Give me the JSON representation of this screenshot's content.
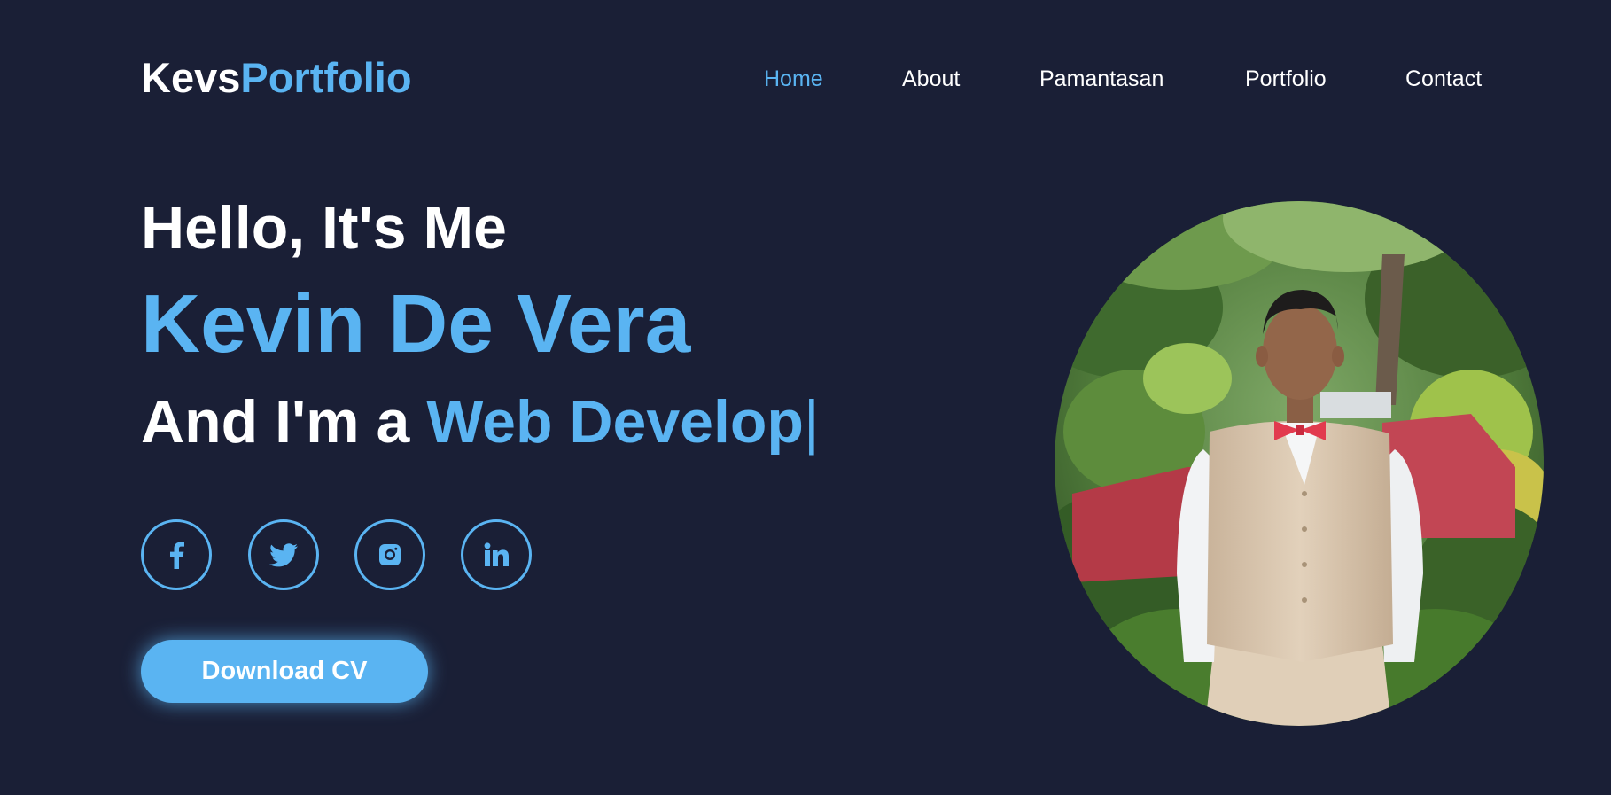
{
  "header": {
    "logo_primary": "Kevs",
    "logo_accent": "Portfolio",
    "nav": [
      {
        "label": "Home",
        "active": true
      },
      {
        "label": "About",
        "active": false
      },
      {
        "label": "Pamantasan",
        "active": false
      },
      {
        "label": "Portfolio",
        "active": false
      },
      {
        "label": "Contact",
        "active": false
      }
    ]
  },
  "hero": {
    "greeting": "Hello, It's Me",
    "name": "Kevin De Vera",
    "role_prefix": "And I'm a ",
    "role_typed": "Web Develop",
    "cursor": "|",
    "socials": [
      {
        "network": "facebook",
        "icon": "facebook-icon"
      },
      {
        "network": "twitter",
        "icon": "twitter-icon"
      },
      {
        "network": "instagram",
        "icon": "instagram-icon"
      },
      {
        "network": "linkedin",
        "icon": "linkedin-icon"
      }
    ],
    "cta_label": "Download CV",
    "photo_alt": "Kevin De Vera"
  },
  "colors": {
    "background": "#1a1f36",
    "accent": "#5ab4f2",
    "text": "#ffffff"
  }
}
